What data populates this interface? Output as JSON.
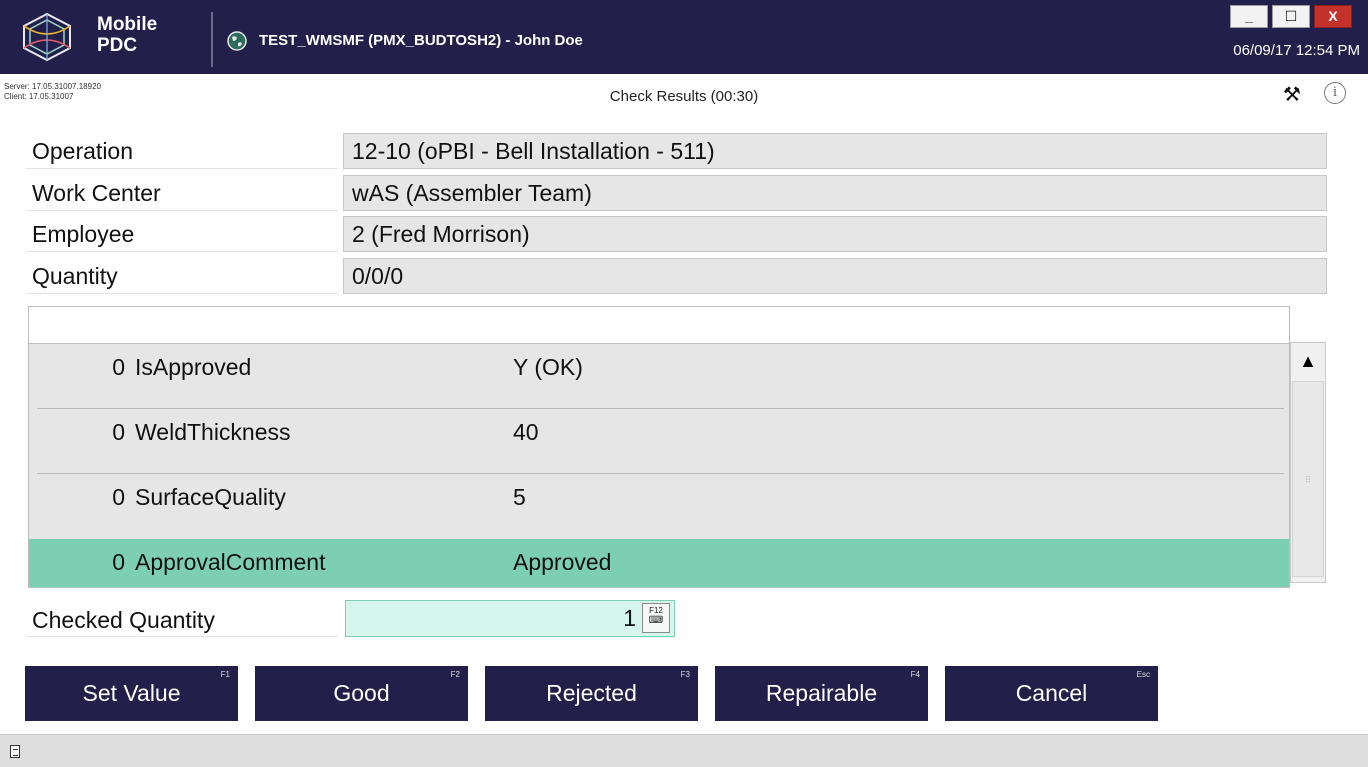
{
  "titlebar": {
    "brand_line1": "Mobile",
    "brand_line2": "PDC",
    "window_title": "TEST_WMSMF (PMX_BUDTOSH2) - John Doe",
    "datetime": "06/09/17 12:54 PM",
    "minimize_label": "_",
    "maximize_label": "☐",
    "close_label": "X"
  },
  "infobar": {
    "server_version": "Server: 17.05.31007.18920",
    "client_version": "Client: 17.05.31007",
    "screen_title": "Check Results (00:30)",
    "info_glyph": "i"
  },
  "fields": [
    {
      "label": "Operation",
      "value": "12-10 (oPBI - Bell Installation - 511)"
    },
    {
      "label": "Work Center",
      "value": "wAS (Assembler Team)"
    },
    {
      "label": "Employee",
      "value": "2 (Fred Morrison)"
    },
    {
      "label": "Quantity",
      "value": "0/0/0"
    }
  ],
  "results": [
    {
      "num": "0",
      "name": "IsApproved",
      "value": "Y (OK)"
    },
    {
      "num": "0",
      "name": "WeldThickness",
      "value": "40"
    },
    {
      "num": "0",
      "name": "SurfaceQuality",
      "value": "5"
    },
    {
      "num": "0",
      "name": "ApprovalComment",
      "value": "Approved"
    }
  ],
  "checked_quantity": {
    "label": "Checked Quantity",
    "value": "1",
    "key_hint": "F12"
  },
  "buttons": [
    {
      "label": "Set Value",
      "key": "F1"
    },
    {
      "label": "Good",
      "key": "F2"
    },
    {
      "label": "Rejected",
      "key": "F3"
    },
    {
      "label": "Repairable",
      "key": "F4"
    },
    {
      "label": "Cancel",
      "key": "Esc"
    }
  ],
  "colors": {
    "header_bg": "#22204a",
    "button_bg": "#22204a",
    "selected_row": "#7dcfb3",
    "input_bg": "#d6f5ec",
    "close_button": "#c4322b"
  }
}
